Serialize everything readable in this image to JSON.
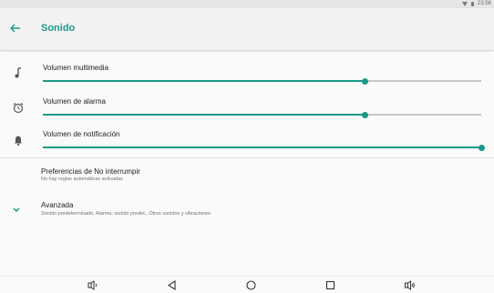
{
  "status_bar": {
    "time": "23:56",
    "icons": [
      "wifi-icon",
      "battery-icon"
    ]
  },
  "toolbar": {
    "title": "Sonido",
    "back_icon": "arrow-back-icon"
  },
  "volumes": [
    {
      "label": "Volumen multimedia",
      "icon": "music-note-icon",
      "level": 0.735
    },
    {
      "label": "Volumen de alarma",
      "icon": "alarm-clock-icon",
      "level": 0.735
    },
    {
      "label": "Volumen de notificación",
      "icon": "bell-icon",
      "level": 1.0
    }
  ],
  "preferences": [
    {
      "title": "Preferencias de No interrumpir",
      "subtitle": "No hay reglas automáticas activadas"
    },
    {
      "title": "Avanzada",
      "subtitle": "Sonido predeterminado, Alarma: sonido predet., Otros sonidos y vibraciones",
      "icon": "chevron-down-icon"
    }
  ],
  "navigation_bar": {
    "items": [
      "volume-down-icon",
      "back-triangle-icon",
      "home-circle-icon",
      "recents-square-icon",
      "volume-up-icon"
    ]
  },
  "colors": {
    "accent": "#1a9a89",
    "toolbar_bg": "#f2f2f2",
    "status_bg": "#e6e6e6",
    "background": "#fafafa",
    "track": "#c7c7c7"
  }
}
